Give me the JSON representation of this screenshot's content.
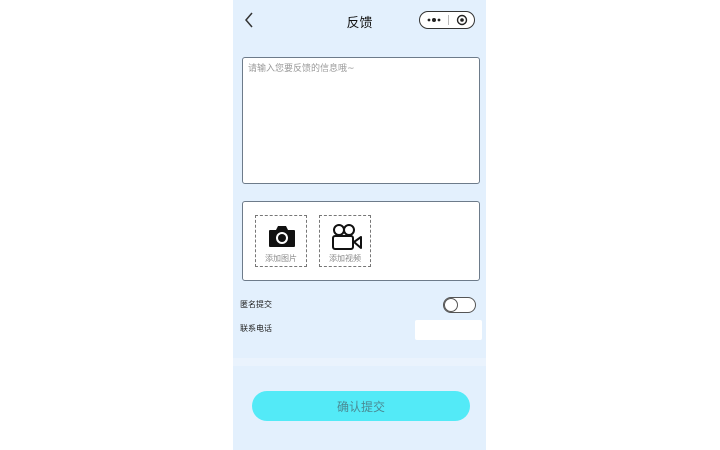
{
  "header": {
    "title": "反馈",
    "back_icon": "chevron-left-icon",
    "more_icon": "more-dots-icon",
    "close_icon": "target-circle-icon"
  },
  "feedback": {
    "value": "",
    "placeholder": "请输入您要反馈的信息哦~"
  },
  "media": {
    "photo_label": "添加图片",
    "photo_icon": "camera-icon",
    "video_label": "添加视频",
    "video_icon": "video-camera-icon"
  },
  "form": {
    "anonymous_label": "匿名提交",
    "anonymous_on": false,
    "phone_label": "联系电话",
    "phone_value": "",
    "phone_placeholder": ""
  },
  "submit": {
    "label": "确认提交"
  },
  "colors": {
    "page_bg": "#e3f0fd",
    "submit_bg": "#53eaf7",
    "submit_text": "#4a8a94"
  }
}
